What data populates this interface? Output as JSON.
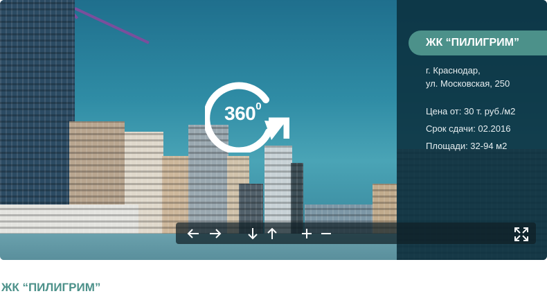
{
  "panorama": {
    "badge_label": "360",
    "badge_superscript": "0",
    "icon": "rotate-360-icon"
  },
  "info": {
    "title": "ЖК “ПИЛИГРИМ”",
    "address_line1": "г. Краснодар,",
    "address_line2": "ул. Московская, 250",
    "price": "Цена от:  30 т. руб./м2",
    "deadline": "Срок сдачи:  02.2016",
    "area": "Площади:  32-94 м2"
  },
  "controls": {
    "left": "arrow-left-icon",
    "right": "arrow-right-icon",
    "down": "arrow-down-icon",
    "up": "arrow-up-icon",
    "zoom_in": "plus-icon",
    "zoom_out": "minus-icon",
    "fullscreen": "fullscreen-icon"
  },
  "page": {
    "title": "ЖК “ПИЛИГРИМ”"
  },
  "colors": {
    "accent": "#4c918a",
    "panel": "#0b2e3c",
    "sky": "#2f8ca5"
  }
}
